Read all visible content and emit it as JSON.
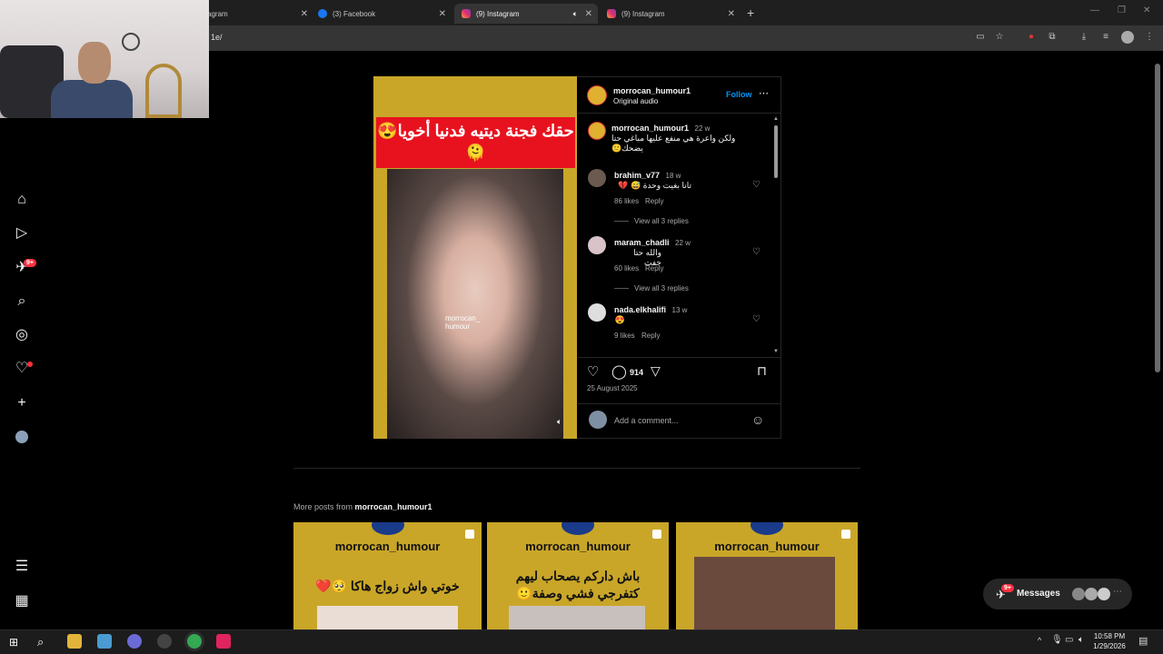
{
  "browser": {
    "tabs": [
      {
        "label": "agram",
        "active": false
      },
      {
        "label": "(3) Facebook",
        "active": false
      },
      {
        "label": "(9) Instagram",
        "active": true
      },
      {
        "label": "(9) Instagram",
        "active": false
      }
    ],
    "url": "1e/"
  },
  "sidebar": {
    "notifications_badge": "9+"
  },
  "post": {
    "author": "morrocan_humour1",
    "audio": "Original audio",
    "follow_label": "Follow",
    "overlay_text": "حقك فجنة ديتيه فدنيا أخويا😍🫠",
    "watermark": "morrocan_\nhumour",
    "caption": {
      "user": "morrocan_humour1",
      "age": "22 w",
      "text": "ولكن واعرة هي منفع عليها مباغي حتا يضحك🙂"
    },
    "comments": [
      {
        "user": "brahim_v77",
        "age": "18 w",
        "text": "تانا بغيت وحدة 😅 💔",
        "likes": "86 likes",
        "reply": "Reply",
        "view_replies": "View all 3 replies"
      },
      {
        "user": "maram_chadli",
        "age": "22 w",
        "text": "والله حتا خفت",
        "likes": "60 likes",
        "reply": "Reply",
        "view_replies": "View all 3 replies"
      },
      {
        "user": "nada.elkhalifi",
        "age": "13 w",
        "text": "😍",
        "likes": "9 likes",
        "reply": "Reply"
      }
    ],
    "comment_count": "914",
    "date": "25 August 2025",
    "add_comment_placeholder": "Add a comment..."
  },
  "more_posts": {
    "label": "More posts from",
    "user": "morrocan_humour1",
    "items": [
      {
        "title": "morrocan_humour",
        "text": "خوتي واش زواج هاكا 🥺❤️"
      },
      {
        "title": "morrocan_humour",
        "text": "باش داركم يصحاب ليهم كتفرجي فشي وصفة🙂"
      },
      {
        "title": "morrocan_humour",
        "text": ""
      }
    ]
  },
  "messages": {
    "label": "Messages",
    "badge": "9+"
  },
  "taskbar": {
    "time": "10:58 PM",
    "date": "1/29/2026"
  },
  "colors": {
    "instagram_blue": "#0095f6",
    "badge_red": "#ff3040",
    "mustard": "#c9a628",
    "banner_red": "#e8121f"
  }
}
